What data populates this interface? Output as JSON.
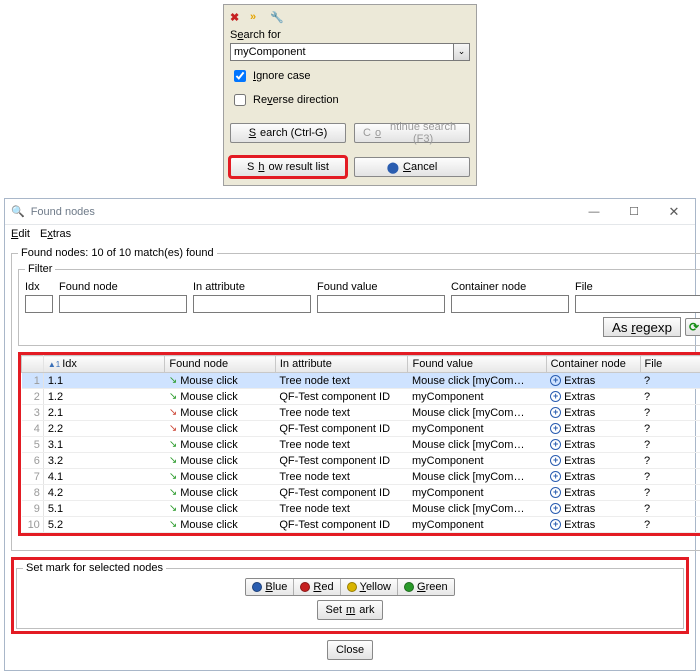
{
  "search_dialog": {
    "label_search_for": "Search for",
    "accel_search_for": "e",
    "value": "myComponent",
    "ignore_case_label": "Ignore case",
    "ignore_case_accel": "I",
    "ignore_case_checked": true,
    "reverse_label": "Reverse direction",
    "reverse_accel": "v",
    "reverse_checked": false,
    "btn_search": "Search (Ctrl-G)",
    "btn_search_accel": "S",
    "btn_continue": "Continue search (F3)",
    "btn_continue_accel": "o",
    "btn_show": "Show result list",
    "btn_show_accel": "h",
    "btn_cancel": "Cancel",
    "btn_cancel_accel": "C"
  },
  "window": {
    "title": "Found nodes",
    "menu_edit": "Edit",
    "menu_edit_accel": "E",
    "menu_extras": "Extras",
    "menu_extras_accel": "x",
    "found_nodes_legend": "Found nodes: 10 of 10 match(es) found",
    "filter_legend": "Filter",
    "filter_labels": {
      "idx": "Idx",
      "found_node": "Found node",
      "in_attribute": "In attribute",
      "found_value": "Found value",
      "container_node": "Container node",
      "file": "File"
    },
    "as_regexp": "As regexp",
    "as_regexp_accel": "r",
    "headers": {
      "idx": "Idx",
      "found_node": "Found node",
      "in_attribute": "In attribute",
      "found_value": "Found value",
      "container_node": "Container node",
      "file": "File"
    },
    "rows": [
      {
        "n": "1",
        "idx": "1.1",
        "node": "Mouse click",
        "arrow": "green",
        "attr": "Tree node text",
        "val": "Mouse click [myCom…",
        "cont": "Extras",
        "file": "?",
        "sel": true
      },
      {
        "n": "2",
        "idx": "1.2",
        "node": "Mouse click",
        "arrow": "green",
        "attr": "QF-Test component ID",
        "val": "myComponent",
        "cont": "Extras",
        "file": "?",
        "sel": false
      },
      {
        "n": "3",
        "idx": "2.1",
        "node": "Mouse click",
        "arrow": "red",
        "attr": "Tree node text",
        "val": "Mouse click [myCom…",
        "cont": "Extras",
        "file": "?",
        "sel": false
      },
      {
        "n": "4",
        "idx": "2.2",
        "node": "Mouse click",
        "arrow": "red",
        "attr": "QF-Test component ID",
        "val": "myComponent",
        "cont": "Extras",
        "file": "?",
        "sel": false
      },
      {
        "n": "5",
        "idx": "3.1",
        "node": "Mouse click",
        "arrow": "green",
        "attr": "Tree node text",
        "val": "Mouse click [myCom…",
        "cont": "Extras",
        "file": "?",
        "sel": false
      },
      {
        "n": "6",
        "idx": "3.2",
        "node": "Mouse click",
        "arrow": "green",
        "attr": "QF-Test component ID",
        "val": "myComponent",
        "cont": "Extras",
        "file": "?",
        "sel": false
      },
      {
        "n": "7",
        "idx": "4.1",
        "node": "Mouse click",
        "arrow": "green",
        "attr": "Tree node text",
        "val": "Mouse click [myCom…",
        "cont": "Extras",
        "file": "?",
        "sel": false
      },
      {
        "n": "8",
        "idx": "4.2",
        "node": "Mouse click",
        "arrow": "green",
        "attr": "QF-Test component ID",
        "val": "myComponent",
        "cont": "Extras",
        "file": "?",
        "sel": false
      },
      {
        "n": "9",
        "idx": "5.1",
        "node": "Mouse click",
        "arrow": "green",
        "attr": "Tree node text",
        "val": "Mouse click [myCom…",
        "cont": "Extras",
        "file": "?",
        "sel": false
      },
      {
        "n": "10",
        "idx": "5.2",
        "node": "Mouse click",
        "arrow": "green",
        "attr": "QF-Test component ID",
        "val": "myComponent",
        "cont": "Extras",
        "file": "?",
        "sel": false
      }
    ],
    "mark_legend": "Set mark for selected nodes",
    "colors": {
      "blue": {
        "label": "Blue",
        "hex": "#2a5db0",
        "accel": "B"
      },
      "red": {
        "label": "Red",
        "hex": "#c62020",
        "accel": "R"
      },
      "yellow": {
        "label": "Yellow",
        "hex": "#d8b400",
        "accel": "Y"
      },
      "green": {
        "label": "Green",
        "hex": "#2a9a2a",
        "accel": "G"
      }
    },
    "btn_set_mark": "Set mark",
    "btn_set_mark_accel": "m",
    "btn_close": "Close"
  }
}
